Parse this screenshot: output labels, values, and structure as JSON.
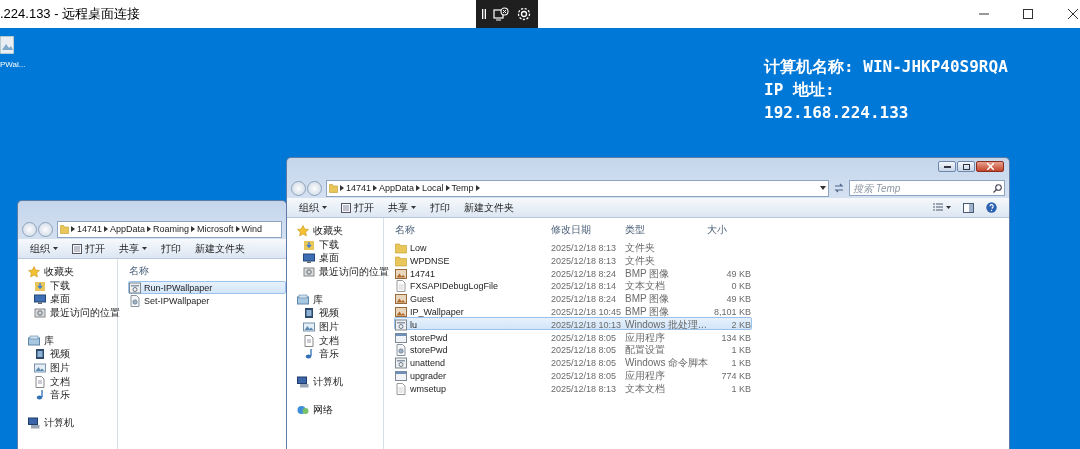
{
  "window": {
    "title": ".224.133 - 远程桌面连接"
  },
  "desktop": {
    "icons": [
      {
        "label": "PWal..."
      }
    ],
    "info_lines": [
      "计算机名称: WIN-JHKP40S9RQA",
      "IP 地址:",
      "192.168.224.133"
    ]
  },
  "explorers": [
    {
      "address": [
        "14741",
        "AppData",
        "Roaming",
        "Microsoft",
        "Wind"
      ],
      "toolbar": [
        {
          "label": "组织",
          "dropdown": true
        },
        {
          "label": "打开",
          "has_icon": true
        },
        {
          "label": "共享",
          "dropdown": true
        },
        {
          "label": "打印"
        },
        {
          "label": "新建文件夹"
        }
      ],
      "nav": [
        {
          "label": "收藏夹",
          "kind": "favorites",
          "children": [
            {
              "label": "下载",
              "kind": "downloads"
            },
            {
              "label": "桌面",
              "kind": "desktop"
            },
            {
              "label": "最近访问的位置",
              "kind": "recent"
            }
          ]
        },
        {
          "label": "库",
          "kind": "library",
          "children": [
            {
              "label": "视频",
              "kind": "video"
            },
            {
              "label": "图片",
              "kind": "pictures"
            },
            {
              "label": "文档",
              "kind": "documents"
            },
            {
              "label": "音乐",
              "kind": "music"
            }
          ]
        },
        {
          "label": "计算机",
          "kind": "computer"
        }
      ],
      "columns": [
        "名称"
      ],
      "rows": [
        {
          "name": "Run-IPWallpaper",
          "kind": "script",
          "selected": true
        },
        {
          "name": "Set-IPWallpaper",
          "kind": "config",
          "selected": false
        }
      ]
    },
    {
      "caption_buttons": true,
      "address": [
        "14741",
        "AppData",
        "Local",
        "Temp"
      ],
      "address_trailing": true,
      "search": {
        "placeholder": "搜索 Temp"
      },
      "toolbar": [
        {
          "label": "组织",
          "dropdown": true
        },
        {
          "label": "打开",
          "has_icon": true
        },
        {
          "label": "共享",
          "dropdown": true
        },
        {
          "label": "打印"
        },
        {
          "label": "新建文件夹"
        }
      ],
      "view_controls": true,
      "nav": [
        {
          "label": "收藏夹",
          "kind": "favorites",
          "children": [
            {
              "label": "下载",
              "kind": "downloads"
            },
            {
              "label": "桌面",
              "kind": "desktop"
            },
            {
              "label": "最近访问的位置",
              "kind": "recent"
            }
          ]
        },
        {
          "label": "库",
          "kind": "library",
          "children": [
            {
              "label": "视频",
              "kind": "video"
            },
            {
              "label": "图片",
              "kind": "pictures"
            },
            {
              "label": "文档",
              "kind": "documents"
            },
            {
              "label": "音乐",
              "kind": "music"
            }
          ]
        },
        {
          "label": "计算机",
          "kind": "computer"
        },
        {
          "label": "网络",
          "kind": "network"
        }
      ],
      "columns": [
        "名称",
        "修改日期",
        "类型",
        "大小"
      ],
      "rows": [
        {
          "name": "Low",
          "date": "2025/12/18 8:13",
          "type": "文件夹",
          "kind": "folder",
          "selected": false
        },
        {
          "name": "WPDNSE",
          "date": "2025/12/18 8:13",
          "type": "文件夹",
          "kind": "folder",
          "selected": false
        },
        {
          "name": "14741",
          "date": "2025/12/18 8:24",
          "type": "BMP 图像",
          "size": "49 KB",
          "kind": "image",
          "selected": false
        },
        {
          "name": "FXSAPIDebugLogFile",
          "date": "2025/12/18 8:14",
          "type": "文本文档",
          "size": "0 KB",
          "kind": "text",
          "selected": false
        },
        {
          "name": "Guest",
          "date": "2025/12/18 8:24",
          "type": "BMP 图像",
          "size": "49 KB",
          "kind": "image",
          "selected": false
        },
        {
          "name": "IP_Wallpaper",
          "date": "2025/12/18 10:45",
          "type": "BMP 图像",
          "size": "8,101 KB",
          "kind": "image",
          "selected": false
        },
        {
          "name": "lu",
          "date": "2025/12/18 10:13",
          "type": "Windows 批处理...",
          "size": "2 KB",
          "kind": "script",
          "selected": true
        },
        {
          "name": "storePwd",
          "date": "2025/12/18 8:05",
          "type": "应用程序",
          "size": "134 KB",
          "kind": "app",
          "selected": false
        },
        {
          "name": "storePwd",
          "date": "2025/12/18 8:05",
          "type": "配置设置",
          "size": "1 KB",
          "kind": "config",
          "selected": false
        },
        {
          "name": "unattend",
          "date": "2025/12/18 8:05",
          "type": "Windows 命令脚本",
          "size": "1 KB",
          "kind": "script",
          "selected": false
        },
        {
          "name": "upgrader",
          "date": "2025/12/18 8:05",
          "type": "应用程序",
          "size": "774 KB",
          "kind": "app",
          "selected": false
        },
        {
          "name": "wmsetup",
          "date": "2025/12/18 8:13",
          "type": "文本文档",
          "size": "1 KB",
          "kind": "text",
          "selected": false
        }
      ]
    }
  ]
}
